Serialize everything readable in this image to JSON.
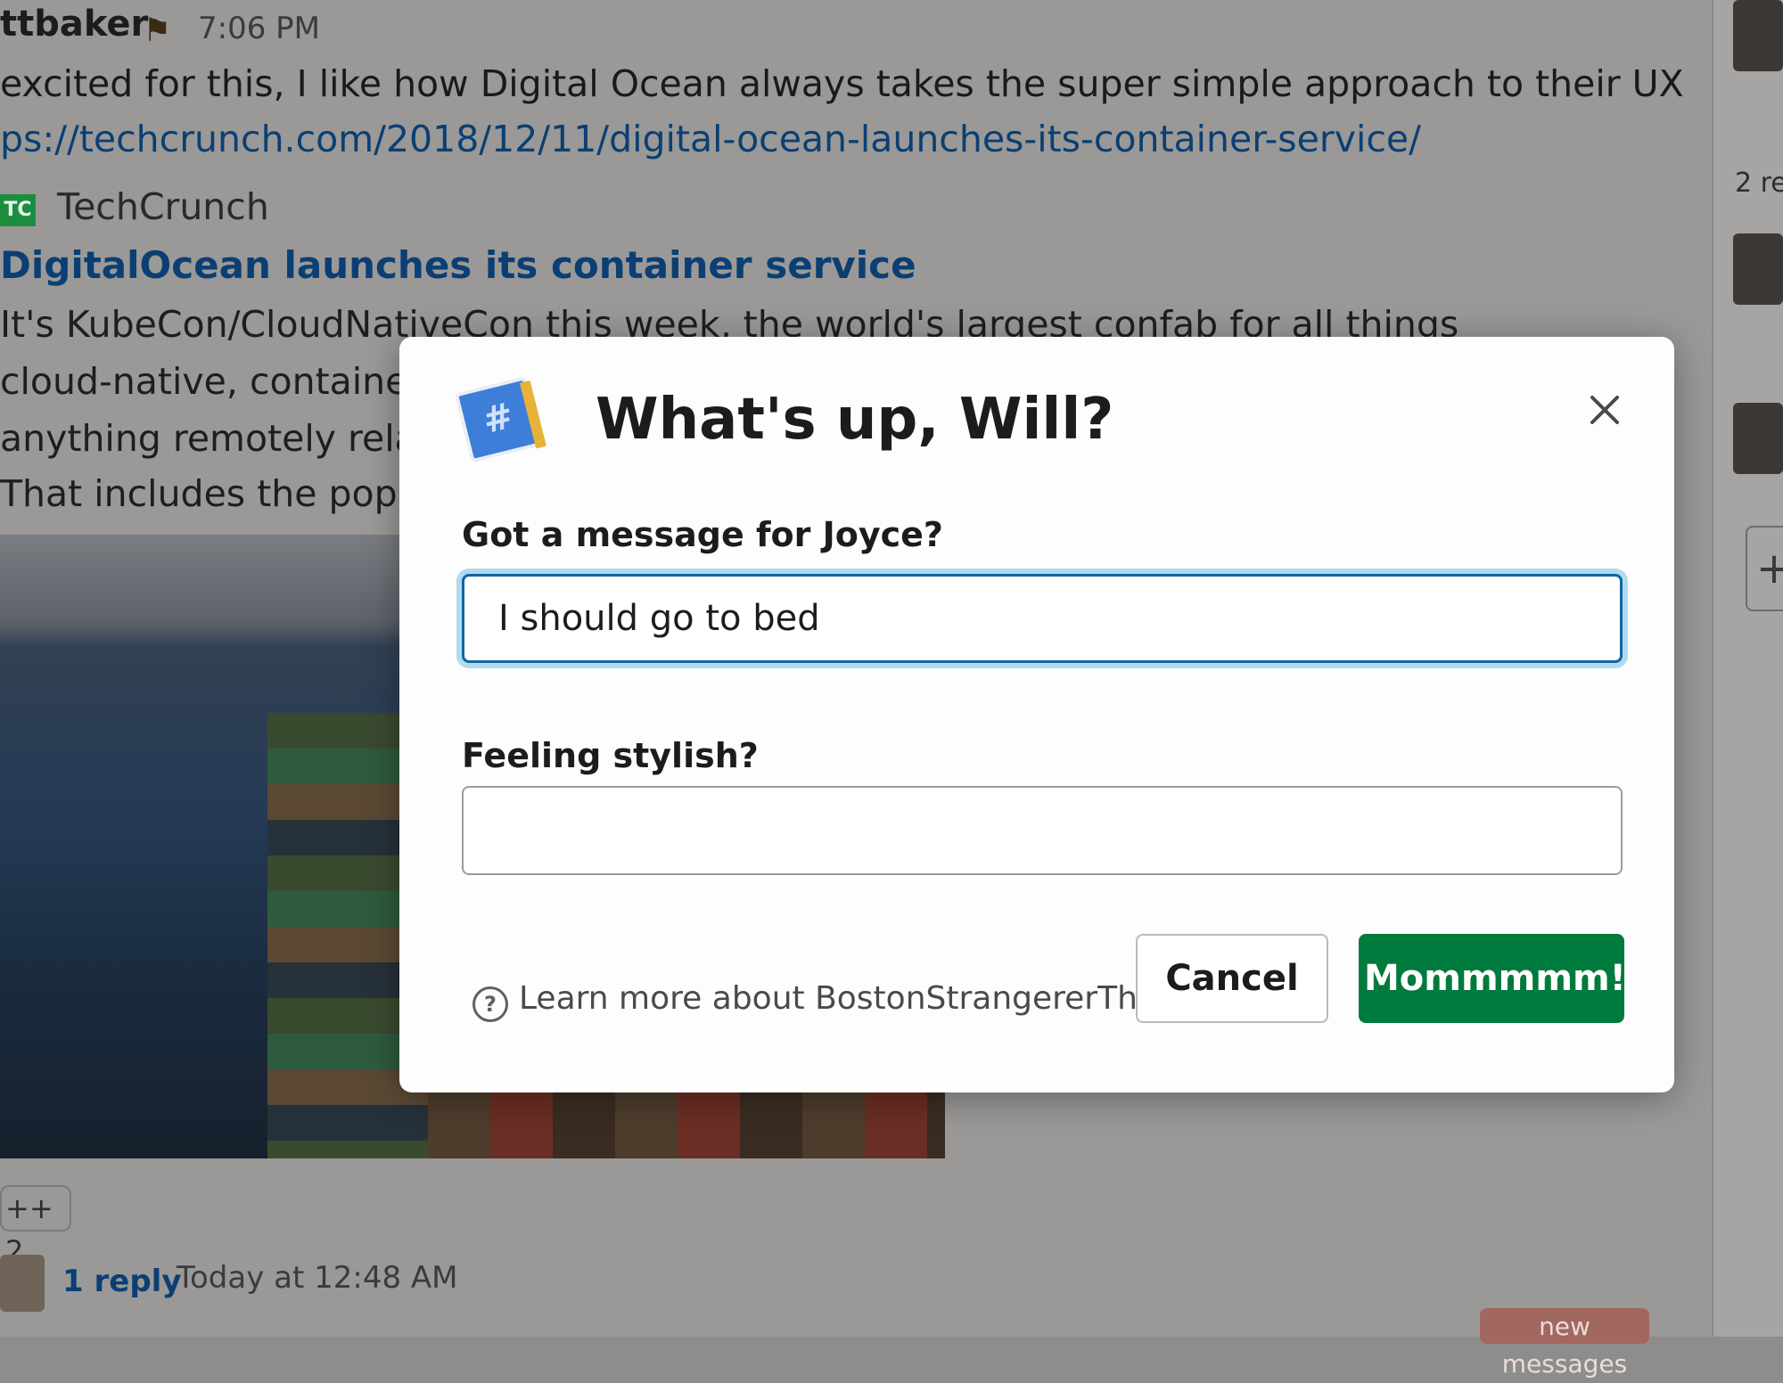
{
  "background": {
    "author": "ttbaker",
    "time": "7:06 PM",
    "message": "excited for this, I like how Digital Ocean always takes the super simple approach to their UX",
    "link": "ps://techcrunch.com/2018/12/11/digital-ocean-launches-its-container-service/",
    "preview": {
      "site_badge": "TC",
      "site": "TechCrunch",
      "title": "DigitalOcean launches its container service",
      "lines": [
        "It's KubeCon/CloudNativeCon this week, the world's largest confab for all things",
        "cloud-native, container",
        "anything remotely relat",
        "That includes the popul"
      ]
    },
    "reaction": "++ 2",
    "reply_count": "1 reply",
    "reply_time": "Today at 12:48 AM",
    "new_messages": "new messages",
    "side_replies": "2 re",
    "side_plus": "+"
  },
  "modal": {
    "title": "What's up, Will?",
    "app_icon": "slack-app-icon",
    "close_icon": "close-icon",
    "fields": [
      {
        "label": "Got a message for Joyce?",
        "value": "I should go to bed"
      },
      {
        "label": "Feeling stylish?",
        "value": ""
      }
    ],
    "help_icon": "question-circle-icon",
    "help_link": "Learn more about BostonStrangererThings",
    "cancel_label": "Cancel",
    "submit_label": "Mommmmm!"
  },
  "colors": {
    "submit": "#007a3d",
    "focus_border": "#1264a3",
    "link": "#0b3f73"
  }
}
